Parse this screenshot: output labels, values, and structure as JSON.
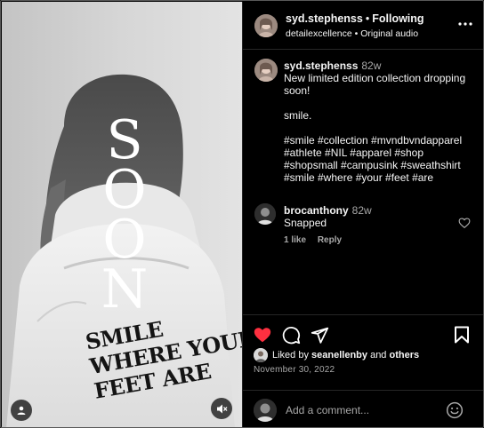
{
  "post": {
    "overlay_text": [
      "S",
      "O",
      "O",
      "N"
    ],
    "print_lines": [
      "SMILE",
      "WHERE YOUR",
      "FEET ARE"
    ]
  },
  "header": {
    "username": "syd.stephenss",
    "separator": "•",
    "follow_label": "Following",
    "subtitle_account": "detailexcellence",
    "subtitle_separator": "•",
    "subtitle_audio": "Original audio"
  },
  "caption": {
    "username": "syd.stephenss",
    "age": "82w",
    "line1": "New limited edition collection dropping",
    "line2": "soon!",
    "line3": "smile.",
    "hashtags": [
      "#smile #collection #mvndbvndapparel",
      "#athlete #NIL #apparel #shop",
      "#shopsmall #campusink #sweathshirt",
      "#smile #where #your #feet #are"
    ]
  },
  "comment": {
    "username": "brocanthony",
    "age": "82w",
    "text": "Snapped",
    "likes_label": "1 like",
    "reply_label": "Reply"
  },
  "actions": {
    "liked_prefix": "Liked by ",
    "liked_user": "seanellenby",
    "liked_and": " and ",
    "liked_others": "others",
    "date": "November 30, 2022"
  },
  "add_comment": {
    "placeholder": "Add a comment..."
  },
  "icons": {
    "like": "heart-filled-icon",
    "comment": "comment-bubble-icon",
    "share": "paper-plane-icon",
    "save": "bookmark-icon",
    "more": "more-dots-icon",
    "emoji": "smiley-icon",
    "tags": "user-tag-icon",
    "mute": "speaker-muted-icon"
  },
  "colors": {
    "like_red": "#ff3040",
    "muted_text": "#a8a8a8",
    "background": "#000000"
  }
}
